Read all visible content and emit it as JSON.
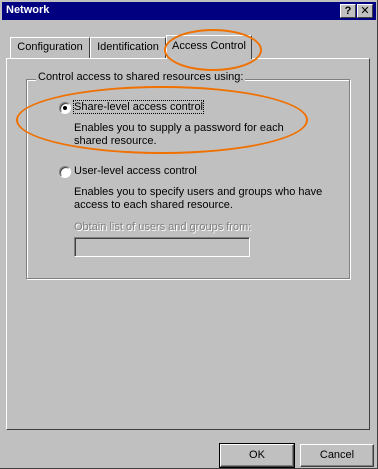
{
  "window": {
    "title": "Network",
    "help_button": "?",
    "close_button": "✕"
  },
  "tabs": [
    {
      "label": "Configuration"
    },
    {
      "label": "Identification"
    },
    {
      "label": "Access Control"
    }
  ],
  "group": {
    "legend": "Control access to shared resources using:"
  },
  "options": {
    "share_level": {
      "label": "Share-level access control",
      "description": "Enables you to supply a password for each shared resource.",
      "selected": true
    },
    "user_level": {
      "label": "User-level access control",
      "description": "Enables you to specify users and groups who have access to each shared resource.",
      "selected": false
    }
  },
  "obtain_list": {
    "label": "Obtain list of users and groups from:",
    "value": ""
  },
  "buttons": {
    "ok": "OK",
    "cancel": "Cancel"
  },
  "colors": {
    "titlebar": "#000080",
    "face": "#c0c0c0",
    "annotation": "#f07000"
  }
}
